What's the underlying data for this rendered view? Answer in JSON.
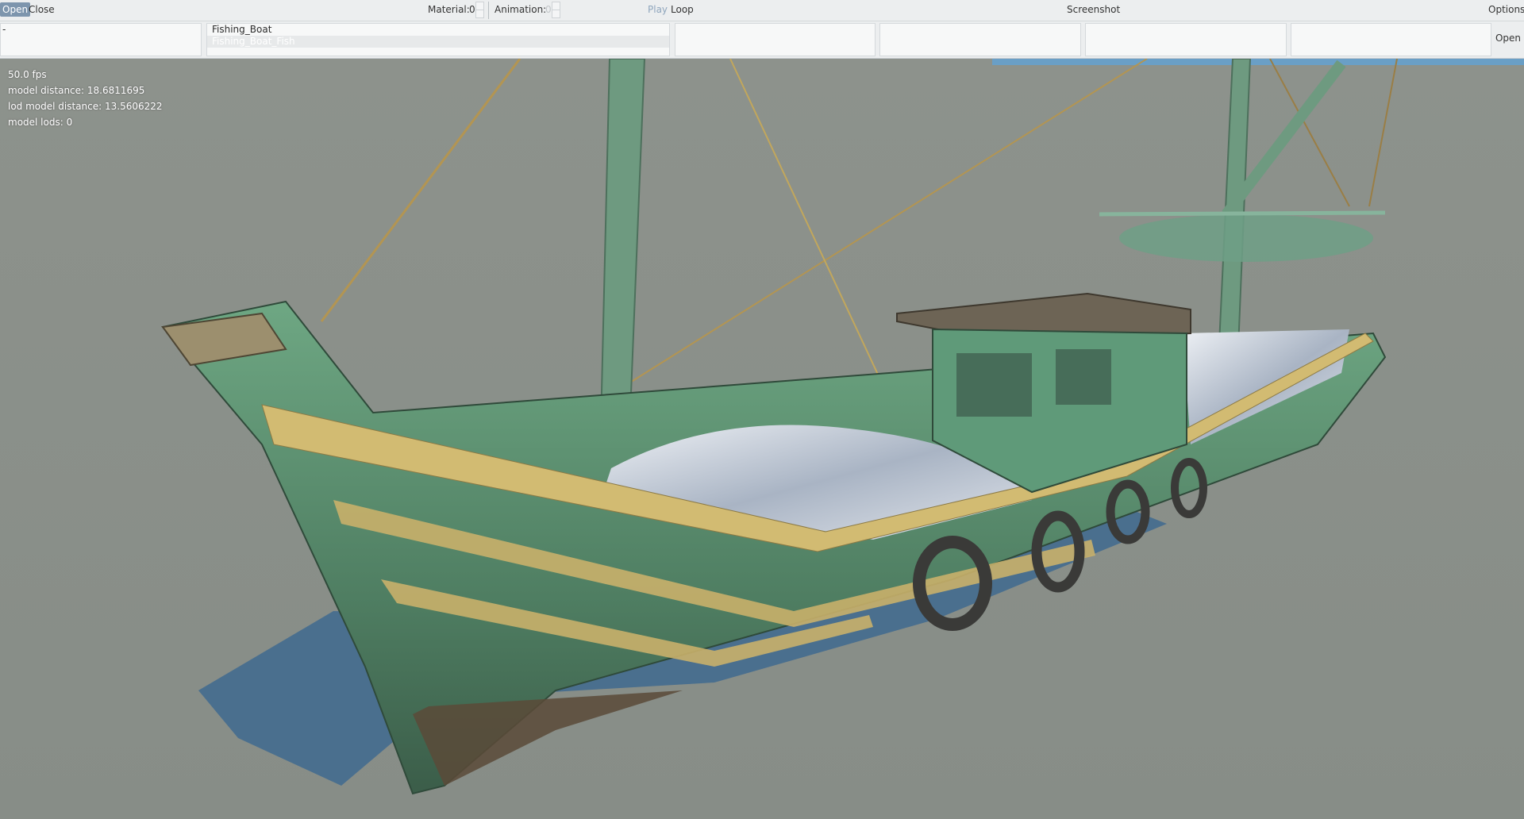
{
  "toolbar": {
    "open_label": "Open",
    "close_label": "Close",
    "material_label": "Material:",
    "material_value": "0",
    "animation_label": "Animation:",
    "animation_value": "0",
    "play_label": "Play",
    "loop_label": "Loop",
    "screenshot_label": "Screenshot",
    "options_label": "Options"
  },
  "lists": {
    "panel1_items": [
      "-"
    ],
    "panel2_items": [
      "Fishing_Boat",
      "Fishing_Boat_Fish"
    ],
    "open_label": "Open"
  },
  "stats": {
    "fps": "50.0 fps",
    "model_distance": "model distance: 18.6811695",
    "lod_model_distance": "lod model distance: 13.5606222",
    "model_lods": "model lods: 0"
  },
  "colors": {
    "accent_active": "#7d95ad",
    "viewport_background": "#8b918b",
    "hull_green": "#5f9a79",
    "trim_wood": "#d2bb72",
    "water_strip": "#6a9fc6"
  }
}
